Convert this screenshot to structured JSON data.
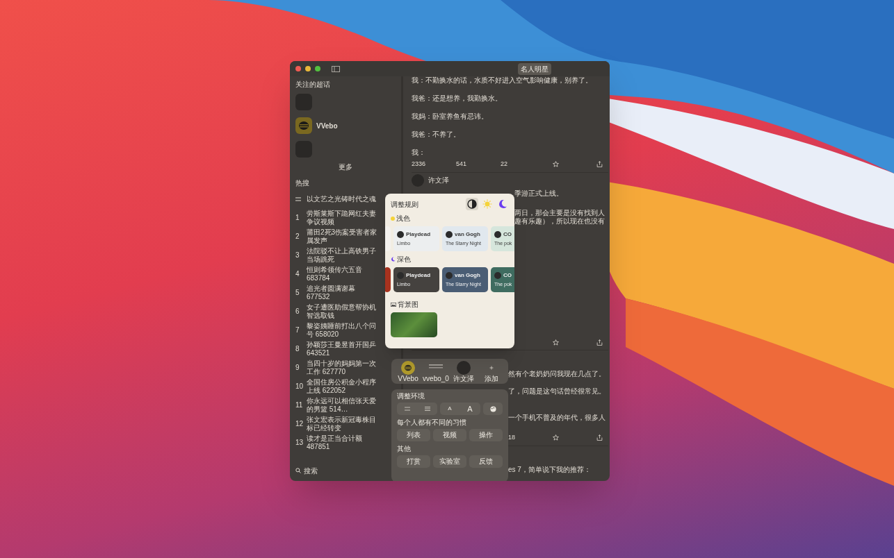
{
  "toolbar": {
    "tabs": [
      {
        "label": "名人明星",
        "selected": true
      }
    ]
  },
  "sidebar": {
    "followed_heading": "关注的超话",
    "followed": [
      {
        "kind": "photo"
      },
      {
        "kind": "logo",
        "name": "VVebo"
      },
      {
        "kind": "photo"
      }
    ],
    "more": "更多",
    "hot_heading": "热搜",
    "hot": [
      {
        "title": "以文艺之光铸时代之魂"
      },
      {
        "rank": "1",
        "title": "劳斯莱斯下跪网红夫妻争议视频"
      },
      {
        "rank": "2",
        "title": "莆田2死3伤案受害者家属发声"
      },
      {
        "rank": "3",
        "title": "法院驳不让上高铁男子当场跳死"
      },
      {
        "rank": "4",
        "title": "恒则希领传六五音 683784"
      },
      {
        "rank": "5",
        "title": "追光者圆满谢幕 677532"
      },
      {
        "rank": "6",
        "title": "女子遭医助假意帮协机智选取钱"
      },
      {
        "rank": "7",
        "title": "黎姿姨睡前打出八个问号 658020"
      },
      {
        "rank": "8",
        "title": "孙颖莎王曼昱首开国乒 643521"
      },
      {
        "rank": "9",
        "title": "当四十岁的妈妈第一次工作 627770"
      },
      {
        "rank": "10",
        "title": "全国住房公积金小程序上线 622052"
      },
      {
        "rank": "11",
        "title": "你永远可以相信张天爱的男篮 514…"
      },
      {
        "rank": "12",
        "title": "张文宏表示新冠毒株目标已经转变"
      },
      {
        "rank": "13",
        "title": "读才是正当合计额 487851"
      }
    ],
    "search": {
      "label": "搜索"
    }
  },
  "posts": [
    {
      "lines": [
        "我：不勤换水的话，水质不好进入空气影响健康，别养了。",
        "我爸：还是想养，我勤换水。",
        "我妈：卧室养鱼有忌讳。",
        "我爸：不养了。",
        "我："
      ],
      "stats": [
        "2336",
        "541",
        "22"
      ]
    },
    {
      "author": "许文泽",
      "lines": [
        "季游正式上线。",
        "两日，那会主要是没有找到人",
        "趣有乐趣），所以现在也没有"
      ]
    },
    {
      "lines": [
        "然有个老奶奶问我现在几点了。",
        "了，问题是这句话曾经很常见。",
        "一个手机不普及的年代，很多人"
      ],
      "stats": [
        "18"
      ]
    },
    {
      "lines": [
        "es 7，简单说下我的推荐："
      ]
    }
  ],
  "accounts": [
    {
      "kind": "logo",
      "name": "VVebo"
    },
    {
      "kind": "lines",
      "name": "vvebo_0"
    },
    {
      "kind": "photo",
      "name": "许文泽"
    },
    {
      "kind": "add",
      "name": "添加"
    }
  ],
  "settings": {
    "heading": "调整环境",
    "font_buttons": [
      "A",
      "A"
    ],
    "habit_label": "每个人都有不同的习惯",
    "habit_buttons": [
      "列表",
      "视频",
      "操作"
    ],
    "other_label": "其他",
    "other_buttons": [
      "打赏",
      "实验室",
      "反馈"
    ]
  },
  "popover": {
    "title": "调整规则",
    "modes": [
      {
        "kind": "auto",
        "selected": true
      },
      {
        "kind": "light",
        "selected": false
      },
      {
        "kind": "dark",
        "selected": false
      }
    ],
    "sections": [
      {
        "kind": "light",
        "label": "浅色",
        "themes": [
          {
            "color": "#f4f2ee"
          },
          {
            "name": "Playdead",
            "work": "Limbo",
            "color": "#eceeef"
          },
          {
            "name": "van Gogh",
            "work": "The Starry Night",
            "color": "#e1e8ee"
          },
          {
            "name": "CO",
            "work": "The pok",
            "color": "#d6e6dc"
          }
        ]
      },
      {
        "kind": "dark",
        "label": "深色",
        "themes": [
          {
            "color": "#a8321e"
          },
          {
            "name": "Playdead",
            "work": "Limbo",
            "color": "#45423f"
          },
          {
            "name": "van Gogh",
            "work": "The Starry Night",
            "color": "#4a5d74"
          },
          {
            "name": "CO",
            "work": "The pok",
            "color": "#3f6c60"
          }
        ]
      }
    ],
    "background_label": "背景图"
  }
}
